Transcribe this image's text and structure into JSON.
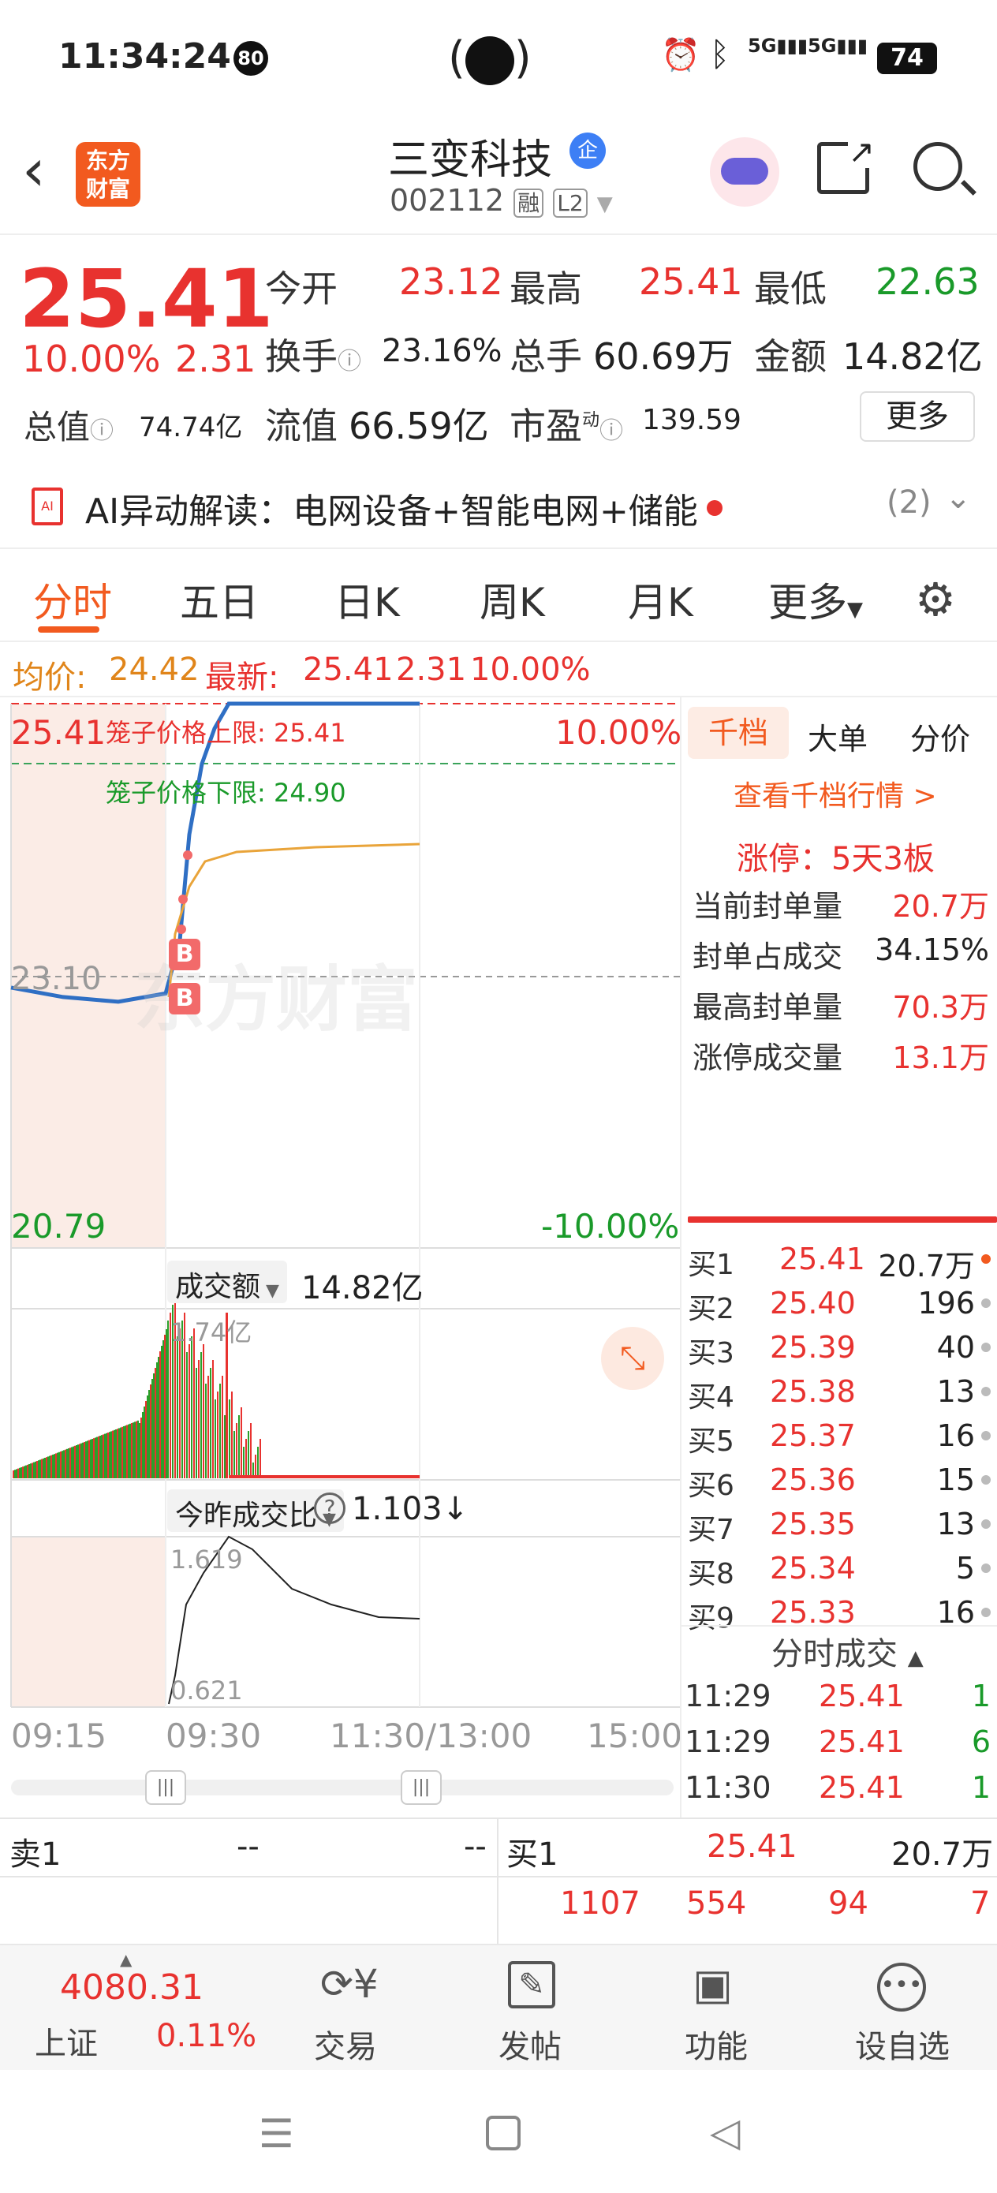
{
  "status": {
    "time": "11:34:24",
    "notif": "80",
    "battery": "74",
    "net1": "5G",
    "net2": "5G"
  },
  "header": {
    "logo": "东方\n财富",
    "logo_l1": "东方",
    "logo_l2": "财富",
    "name": "三变科技",
    "badge": "企",
    "code": "002112",
    "tag1": "融",
    "tag2": "L2"
  },
  "quote": {
    "price": "25.41",
    "pct": "10.00%",
    "chg": "2.31",
    "open_l": "今开",
    "open_v": "23.12",
    "high_l": "最高",
    "high_v": "25.41",
    "low_l": "最低",
    "low_v": "22.63",
    "turn_l": "换手",
    "turn_v": "23.16%",
    "vol_l": "总手",
    "vol_v": "60.69万",
    "amt_l": "金额",
    "amt_v": "14.82亿",
    "mcap_l": "总值",
    "mcap_v": "74.74亿",
    "fmcap_l": "流值",
    "fmcap_v": "66.59亿",
    "pe_l": "市盈",
    "pe_sup": "动",
    "pe_v": "139.59",
    "more": "更多"
  },
  "ai": {
    "label": "AI异动解读：电网设备+智能电网+储能",
    "count": "(2)"
  },
  "tabs": [
    "分时",
    "五日",
    "日K",
    "周K",
    "月K",
    "更多"
  ],
  "info": {
    "avg_l": "均价:",
    "avg_v": "24.42",
    "last_l": "最新:",
    "last_v": "25.41",
    "chg": "2.31",
    "pct": "10.00%"
  },
  "chart": {
    "top_price": "25.41",
    "top_pct": "10.00%",
    "mid_price": "23.10",
    "bot_price": "20.79",
    "bot_pct": "-10.00%",
    "cage_up": "笼子价格上限: 25.41",
    "cage_dn": "笼子价格下限: 24.90",
    "watermark": "东方财富",
    "vol_title": "成交额",
    "vol_value": "14.82亿",
    "vol_max": "1.74亿",
    "ratio_title": "今昨成交比",
    "ratio_value": "1.103↓",
    "ratio_max": "1.619",
    "ratio_min": "0.621",
    "times": [
      "09:15",
      "09:30",
      "11:30/13:00",
      "15:00"
    ],
    "b_mark": "B"
  },
  "chart_data": {
    "type": "line",
    "title": "",
    "price_range": [
      20.79,
      25.41
    ],
    "prev_close": 23.1,
    "series": [
      {
        "name": "",
        "x": [
          "09:15",
          "09:20",
          "09:25",
          "09:30",
          "09:35",
          "09:40",
          "09:50",
          "10:00",
          "10:30",
          "11:00",
          "11:29"
        ],
        "values": [
          23.0,
          22.92,
          22.88,
          22.95,
          23.4,
          24.3,
          24.9,
          25.2,
          25.41,
          25.41,
          25.41
        ]
      }
    ]
  },
  "side": {
    "tabs": [
      "千档",
      "大单",
      "分价"
    ],
    "link": "查看千档行情 >",
    "limit": "涨停：5天3板",
    "rows": [
      {
        "l": "当前封单量",
        "v": "20.7万"
      },
      {
        "l": "封单占成交",
        "v": "34.15%"
      },
      {
        "l": "最高封单量",
        "v": "70.3万"
      },
      {
        "l": "涨停成交量",
        "v": "13.1万"
      }
    ],
    "book": [
      {
        "l": "买1",
        "p": "25.41",
        "v": "20.7万"
      },
      {
        "l": "买2",
        "p": "25.40",
        "v": "196"
      },
      {
        "l": "买3",
        "p": "25.39",
        "v": "40"
      },
      {
        "l": "买4",
        "p": "25.38",
        "v": "13"
      },
      {
        "l": "买5",
        "p": "25.37",
        "v": "16"
      },
      {
        "l": "买6",
        "p": "25.36",
        "v": "15"
      },
      {
        "l": "买7",
        "p": "25.35",
        "v": "13"
      },
      {
        "l": "买8",
        "p": "25.34",
        "v": "5"
      },
      {
        "l": "买9",
        "p": "25.33",
        "v": "16"
      }
    ],
    "ticks_title": "分时成交",
    "ticks": [
      {
        "t": "11:29",
        "p": "25.41",
        "v": "1"
      },
      {
        "t": "11:29",
        "p": "25.41",
        "v": "6"
      },
      {
        "t": "11:30",
        "p": "25.41",
        "v": "1"
      }
    ]
  },
  "bottom": {
    "sell_l": "卖1",
    "sell_p": "--",
    "sell_v": "--",
    "buy_l": "买1",
    "buy_p": "25.41",
    "buy_v": "20.7万",
    "q": [
      "1107",
      "554",
      "94",
      "7"
    ]
  },
  "nav": {
    "index_v": "4080.31",
    "index_l": "上证",
    "index_pct": "0.11%",
    "items": [
      "交易",
      "发帖",
      "功能",
      "设自选"
    ]
  }
}
